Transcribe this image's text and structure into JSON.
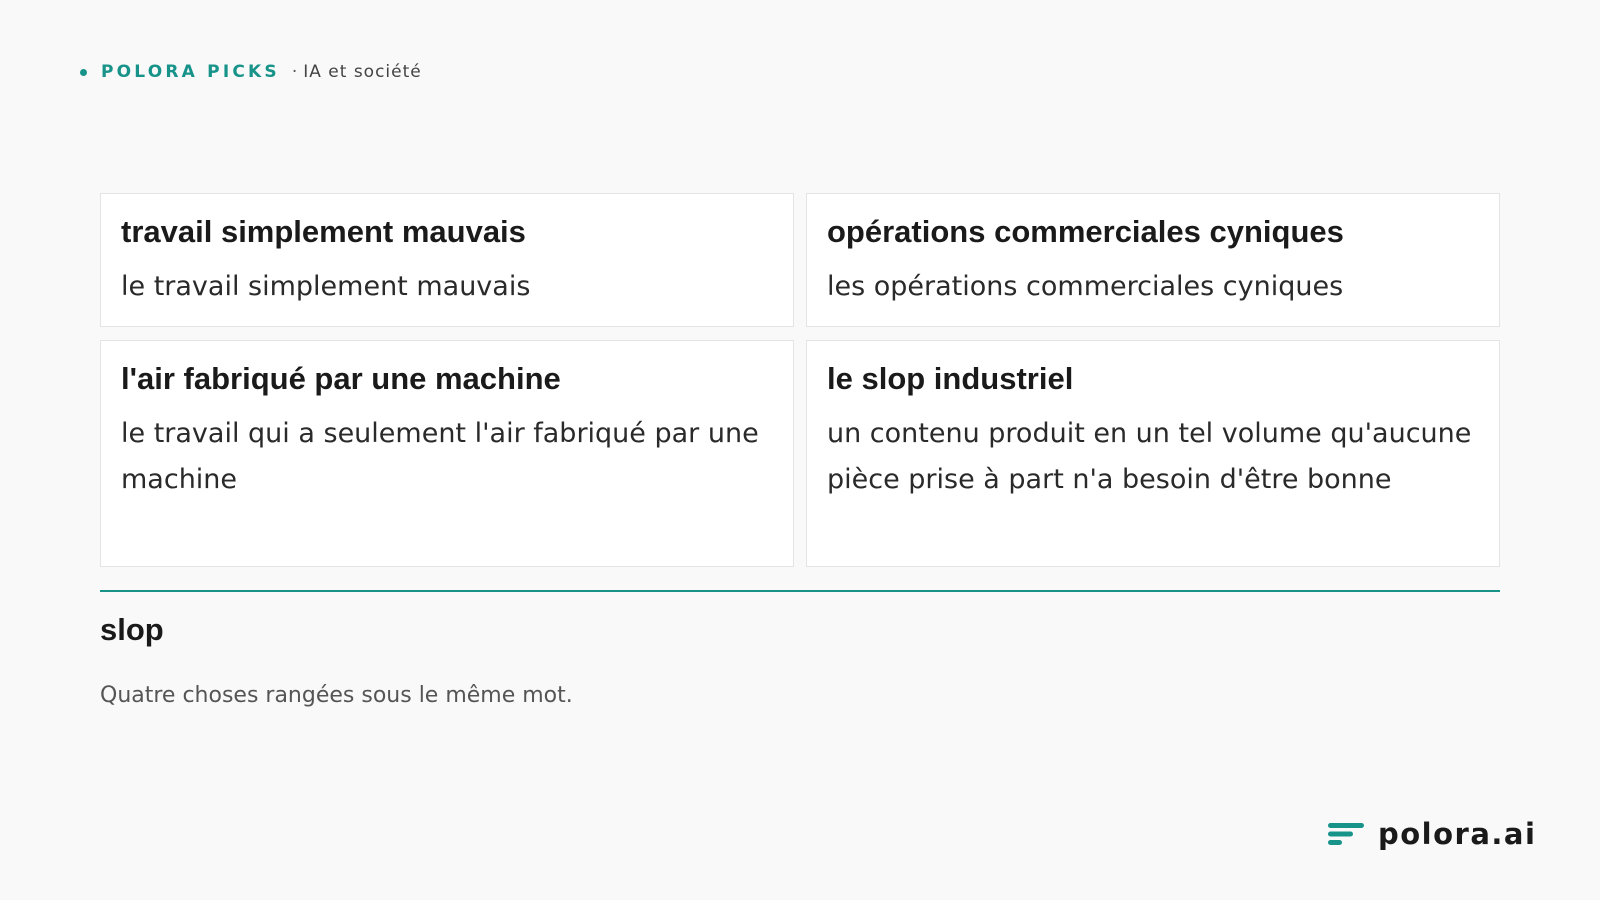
{
  "header": {
    "brand": "POLORA PICKS",
    "separator": "·",
    "topic": "IA et société"
  },
  "cards": [
    {
      "title": "travail simplement mauvais",
      "description": "le travail simplement mauvais"
    },
    {
      "title": "opérations commerciales cyniques",
      "description": "les opérations commerciales cyniques"
    },
    {
      "title": "l'air fabriqué par une machine",
      "description": "le travail qui a seulement l'air fabriqué par une machine"
    },
    {
      "title": "le slop industriel",
      "description": "un contenu produit en un tel volume qu'aucune pièce prise à part n'a besoin d'être bonne"
    }
  ],
  "summary": {
    "term": "slop",
    "caption": "Quatre choses rangées sous le même mot."
  },
  "footer": {
    "logo_text": "polora.ai"
  },
  "colors": {
    "accent": "#17938a",
    "background": "#f9f9f9",
    "card": "#ffffff"
  },
  "icons": {
    "header_dot": "bullet-dot-icon",
    "logo": "polora-logo-icon"
  }
}
